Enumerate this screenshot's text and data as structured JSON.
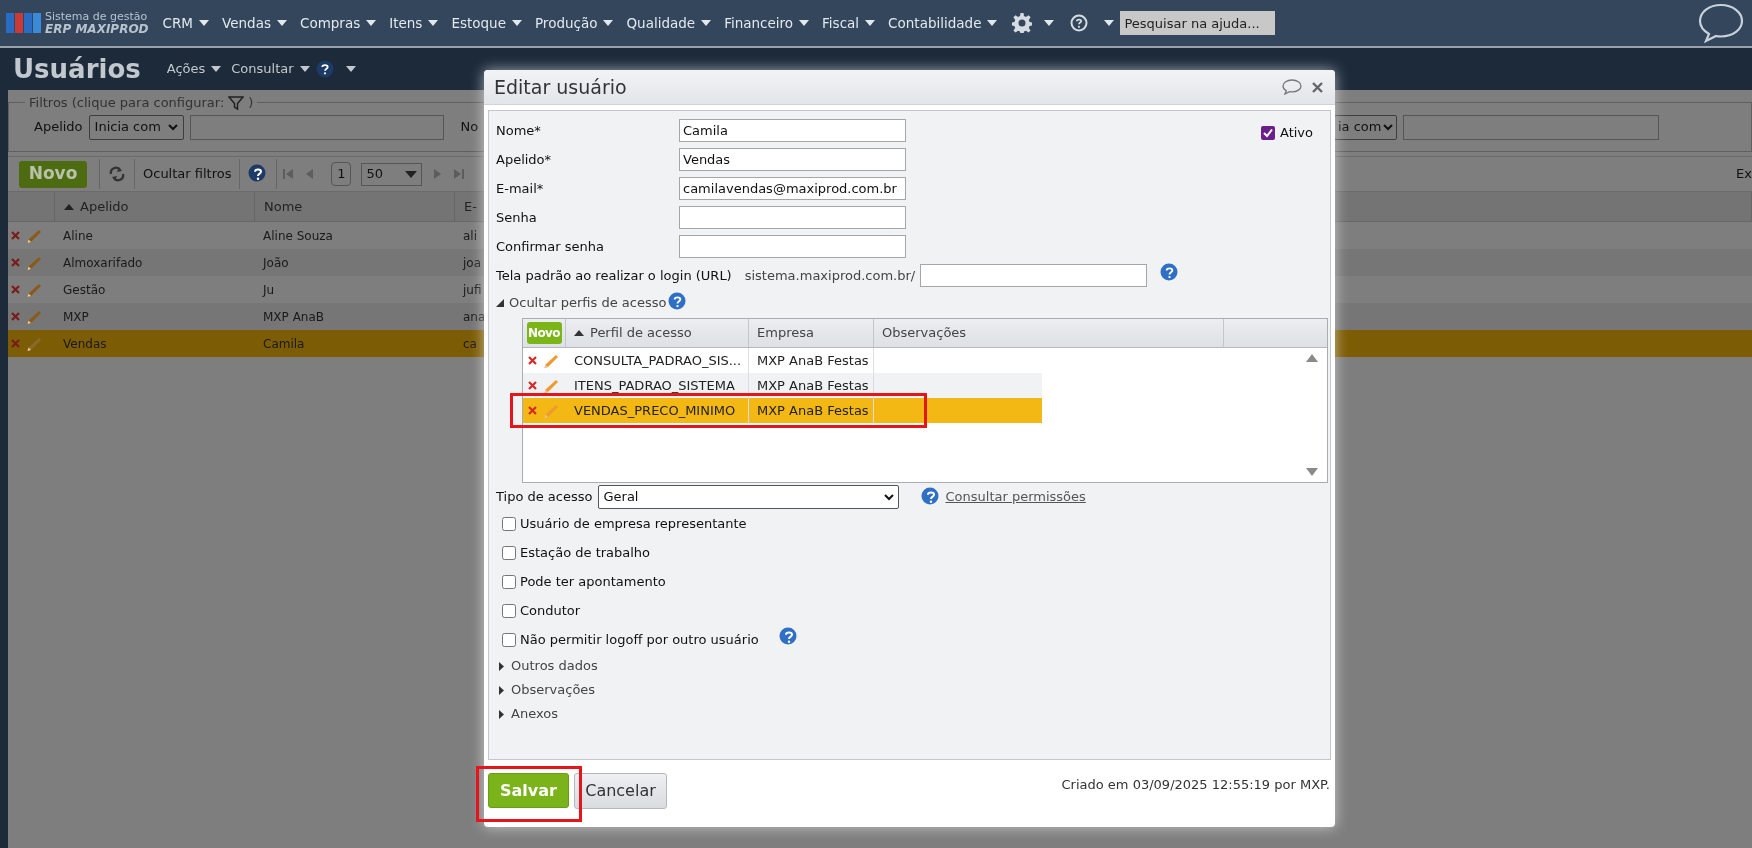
{
  "top_nav": {
    "logo_line1": "Sistema de gestão",
    "logo_line2": "ERP MAXIPROD",
    "menus": [
      "CRM",
      "Vendas",
      "Compras",
      "Itens",
      "Estoque",
      "Produção",
      "Qualidade",
      "Financeiro",
      "Fiscal",
      "Contabilidade"
    ],
    "search": {
      "placeholder": "Pesquisar na ajuda..."
    }
  },
  "page": {
    "title": "Usuários",
    "menus": [
      "Ações",
      "Consultar"
    ],
    "filters": {
      "legend": "Filtros (clique para configurar:",
      "legend_end": ")",
      "label": "Apelido",
      "operator": "Inicia com",
      "cut_label": "No",
      "cut_operator": "ia com"
    },
    "toolbar": {
      "new": "Novo",
      "hide_filters": "Ocultar filtros",
      "page": "1",
      "page_size": "50",
      "cut_text": "Ex"
    },
    "table": {
      "columns": [
        {
          "label": "Apelido",
          "sorted": true
        },
        {
          "label": "Nome",
          "sorted": false
        },
        {
          "label": "E-",
          "sorted": false
        }
      ],
      "rows": [
        {
          "apelido": "Aline",
          "nome": "Aline Souza",
          "email": "ali",
          "selected": false
        },
        {
          "apelido": "Almoxarifado",
          "nome": "João",
          "email": "joa",
          "selected": false
        },
        {
          "apelido": "Gestão",
          "nome": "Ju",
          "email": "jufi",
          "selected": false
        },
        {
          "apelido": "MXP",
          "nome": "MXP AnaB",
          "email": "ana",
          "selected": false
        },
        {
          "apelido": "Vendas",
          "nome": "Camila",
          "email": "ca",
          "selected": true
        }
      ]
    }
  },
  "dialog": {
    "title": "Editar usuário",
    "fields": [
      {
        "label": "Nome*",
        "value": "Camila"
      },
      {
        "label": "Apelido*",
        "value": "Vendas"
      },
      {
        "label": "E-mail*",
        "value": "camilavendas@maxiprod.com.br"
      },
      {
        "label": "Senha"
      },
      {
        "label": "Confirmar senha"
      }
    ],
    "active": {
      "label": "Ativo",
      "checked": true
    },
    "url": {
      "label": "Tela padrão ao realizar o login (URL)",
      "prefix": "sistema.maxiprod.com.br/"
    },
    "profiles": {
      "toggle": "Ocultar perfis de acesso",
      "expanded": true,
      "new": "Novo",
      "columns": [
        {
          "label": "Perfil de acesso",
          "sorted": true
        },
        {
          "label": "Empresa",
          "sorted": false
        },
        {
          "label": "Observações",
          "sorted": false
        }
      ],
      "rows": [
        {
          "profile": "CONSULTA_PADRAO_SIS...",
          "company": "MXP AnaB Festas",
          "selected": false,
          "highlighted": false
        },
        {
          "profile": "ITENS_PADRAO_SISTEMA",
          "company": "MXP AnaB Festas",
          "selected": false,
          "highlighted": false
        },
        {
          "profile": "VENDAS_PRECO_MINIMO",
          "company": "MXP AnaB Festas",
          "selected": true,
          "highlighted": true
        }
      ]
    },
    "access_type": {
      "label": "Tipo de acesso",
      "value": "Geral",
      "link": "Consultar permissões"
    },
    "options": [
      {
        "label": "Usuário de empresa representante",
        "checked": false,
        "help": false
      },
      {
        "label": "Estação de trabalho",
        "checked": false,
        "help": false
      },
      {
        "label": "Pode ter apontamento",
        "checked": false,
        "help": false
      },
      {
        "label": "Condutor",
        "checked": false,
        "help": false
      },
      {
        "label": "Não permitir logoff por outro usuário",
        "checked": false,
        "help": true
      }
    ],
    "sections": [
      {
        "label": "Outros dados",
        "expanded": false
      },
      {
        "label": "Observações",
        "expanded": false
      },
      {
        "label": "Anexos",
        "expanded": false
      }
    ],
    "save": {
      "label": "Salvar",
      "highlighted": true
    },
    "cancel": {
      "label": "Cancelar"
    },
    "footer_note": "Criado em 03/09/2025 12:55:19 por MXP."
  }
}
